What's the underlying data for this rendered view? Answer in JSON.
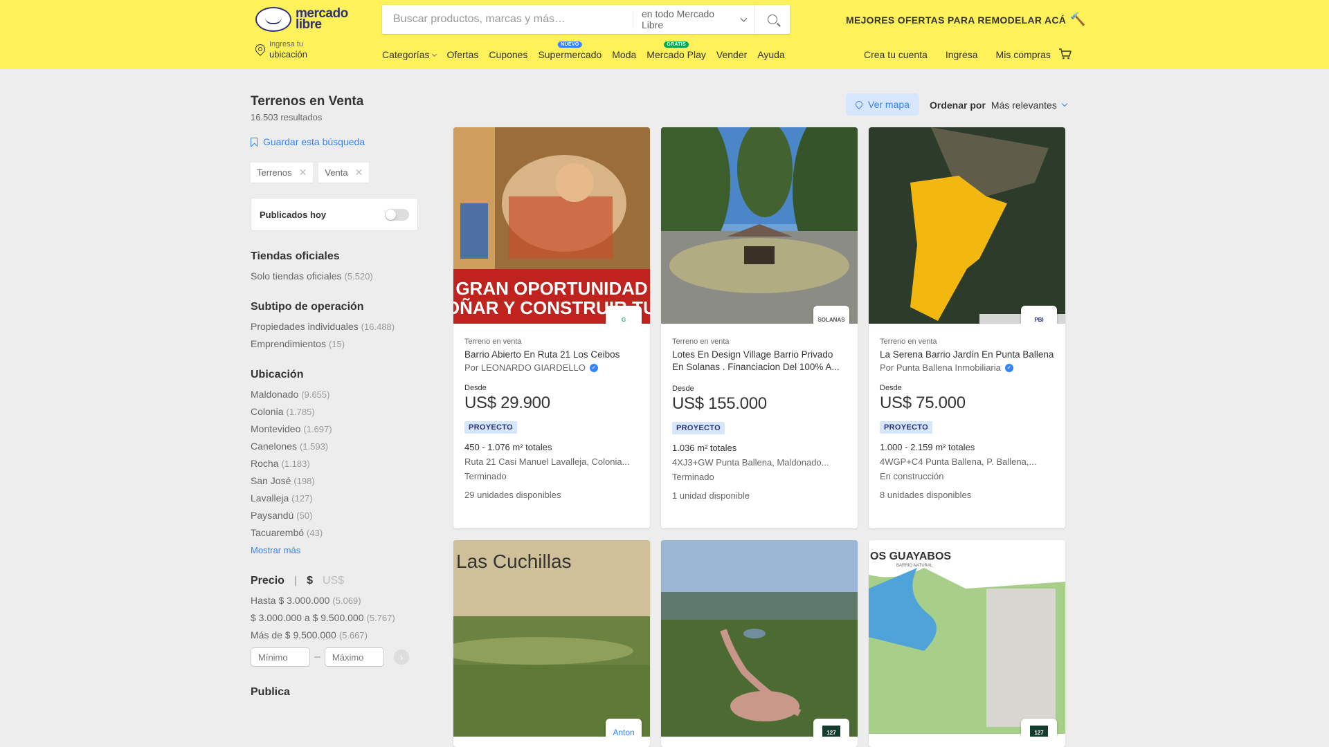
{
  "header": {
    "logo_text": "mercado libre",
    "search_placeholder": "Buscar productos, marcas y más…",
    "search_scope": "en todo Mercado Libre",
    "promo": "MEJORES OFERTAS PARA REMODELAR ACÁ",
    "location_line1": "Ingresa tu",
    "location_line2": "ubicación",
    "nav": [
      {
        "label": "Categorías",
        "badge": ""
      },
      {
        "label": "Ofertas",
        "badge": ""
      },
      {
        "label": "Cupones",
        "badge": ""
      },
      {
        "label": "Supermercado",
        "badge": "NUEVO"
      },
      {
        "label": "Moda",
        "badge": ""
      },
      {
        "label": "Mercado Play",
        "badge": "GRATIS"
      },
      {
        "label": "Vender",
        "badge": ""
      },
      {
        "label": "Ayuda",
        "badge": ""
      }
    ],
    "account": [
      "Crea tu cuenta",
      "Ingresa",
      "Mis compras"
    ],
    "colors": {
      "header_bg": "#fff159",
      "accent": "#3483fa"
    }
  },
  "sidebar": {
    "title": "Terrenos en Venta",
    "results": "16.503 resultados",
    "save_search": "Guardar esta búsqueda",
    "chips": [
      "Terrenos",
      "Venta"
    ],
    "today_label": "Publicados hoy",
    "today_toggle": false,
    "official": {
      "heading": "Tiendas oficiales",
      "items": [
        {
          "label": "Solo tiendas oficiales",
          "count": "(5.520)"
        }
      ]
    },
    "subtype": {
      "heading": "Subtipo de operación",
      "items": [
        {
          "label": "Propiedades individuales",
          "count": "(16.488)"
        },
        {
          "label": "Emprendimientos",
          "count": "(15)"
        }
      ]
    },
    "location": {
      "heading": "Ubicación",
      "items": [
        {
          "label": "Maldonado",
          "count": "(9.655)"
        },
        {
          "label": "Colonia",
          "count": "(1.785)"
        },
        {
          "label": "Montevideo",
          "count": "(1.697)"
        },
        {
          "label": "Canelones",
          "count": "(1.593)"
        },
        {
          "label": "Rocha",
          "count": "(1.183)"
        },
        {
          "label": "San José",
          "count": "(198)"
        },
        {
          "label": "Lavalleja",
          "count": "(127)"
        },
        {
          "label": "Paysandú",
          "count": "(50)"
        },
        {
          "label": "Tacuarembó",
          "count": "(43)"
        }
      ],
      "more": "Mostrar más"
    },
    "price": {
      "heading": "Precio",
      "currency_a": "$",
      "currency_b": "US$",
      "items": [
        {
          "label": "Hasta $ 3.000.000",
          "count": "(5.069)"
        },
        {
          "label": "$ 3.000.000 a $ 9.500.000",
          "count": "(5.767)"
        },
        {
          "label": "Más de $ 9.500.000",
          "count": "(5.667)"
        }
      ],
      "min_placeholder": "Mínimo",
      "max_placeholder": "Máximo"
    },
    "publica": "Publica"
  },
  "toolbar": {
    "map_label": "Ver mapa",
    "order_label": "Ordenar por",
    "order_value": "Más relevantes"
  },
  "cards": [
    {
      "type": "Terreno en venta",
      "title": "Barrio Abierto En Ruta 21 Los Ceibos",
      "by": "Por LEONARDO GIARDELLO",
      "verified": true,
      "desde": "Desde",
      "price": "US$ 29.900",
      "tag": "PROYECTO",
      "area": "450 - 1.076 m² totales",
      "address": "Ruta 21 Casi Manuel Lavalleja, Colonia...",
      "state": "Terminado",
      "units": "29 unidades disponibles",
      "banner1": "GRAN OPORTUNIDAD",
      "banner2": "A SOÑAR Y CONSTRUIR TU CA",
      "brand": "G"
    },
    {
      "type": "Terreno en venta",
      "title": "Lotes En Design Village Barrio Privado En Solanas . Financiacion Del 100% A...",
      "by": "",
      "verified": false,
      "desde": "Desde",
      "price": "US$ 155.000",
      "tag": "PROYECTO",
      "area": "1.036 m² totales",
      "address": "4XJ3+GW Punta Ballena, Maldonado...",
      "state": "Terminado",
      "units": "1 unidad disponible",
      "brand": "SOLANAS"
    },
    {
      "type": "Terreno en venta",
      "title": "La Serena Barrio Jardín En Punta Ballena",
      "by": "Por Punta Ballena Inmobiliaria",
      "verified": true,
      "desde": "Desde",
      "price": "US$ 75.000",
      "tag": "PROYECTO",
      "area": "1.000 - 2.159 m² totales",
      "address": "4WGP+C4 Punta Ballena, P. Ballena,...",
      "state": "En construcción",
      "units": "8 unidades disponibles",
      "brand": "PBI"
    },
    {
      "overlay": "Las Cuchillas",
      "brand": "Anton"
    },
    {
      "overlay": "",
      "brand": "127"
    },
    {
      "overlay": "OS GUAYABOS",
      "sub": "BARRIO NATURAL",
      "brand": "127"
    }
  ]
}
